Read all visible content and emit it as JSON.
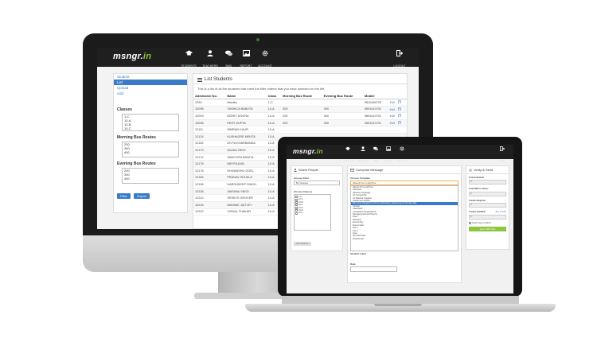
{
  "brand": {
    "logo_text": "msngr.",
    "logo_suffix": "in",
    "accent_color": "#8cc63f",
    "link_color": "#3a7bc8"
  },
  "nav": {
    "items": [
      {
        "label": "STUDENTS",
        "icon": "graduation-cap-icon"
      },
      {
        "label": "TEACHERS",
        "icon": "user-icon"
      },
      {
        "label": "SMS",
        "icon": "chat-bubbles-icon"
      },
      {
        "label": "REPORT",
        "icon": "image-report-icon"
      },
      {
        "label": "ACCOUNT",
        "icon": "gear-icon"
      }
    ],
    "logout": "LOGOUT"
  },
  "desktop": {
    "sidebar": {
      "links": [
        "Student",
        "List",
        "Upload",
        "Add"
      ],
      "classes_label": "Classes",
      "classes": [
        "1-C",
        "10-A",
        "10-B",
        "10-C"
      ],
      "morning_label": "Morning Bus Routes",
      "morning_routes": [
        "200",
        "300",
        "400"
      ],
      "evening_label": "Evening Bus Routes",
      "evening_routes": [
        "200",
        "300",
        "400"
      ],
      "filter_btn": "Filter",
      "export_btn": "Export"
    },
    "main": {
      "title": "List Students",
      "intro": "This is a list of all the students that meet the filter criteria that you have selected on the left.",
      "columns": [
        "Admission No.",
        "Name",
        "Class",
        "Morning Bus Route",
        "Evening Bus Route",
        "Mobile"
      ],
      "rows": [
        {
          "adm": "1299",
          "name": "Manika",
          "cls": "1-C",
          "mbr": "",
          "ebr": "",
          "mobile": "9810489729",
          "edit": "Edit"
        },
        {
          "adm": "12098",
          "name": "YASHICA BABUTA",
          "cls": "10-A",
          "mbr": "300",
          "ebr": "400",
          "mobile": "9891410701",
          "edit": "Edit"
        },
        {
          "adm": "12093",
          "name": "MOHIT DOGRA",
          "cls": "10-A",
          "mbr": "200",
          "ebr": "300",
          "mobile": "9891410701",
          "edit": "Edit"
        },
        {
          "adm": "12098",
          "name": "KRITI GUPTA",
          "cls": "10-A",
          "mbr": "300",
          "ebr": "400",
          "mobile": "9891410701",
          "edit": "Edit"
        },
        {
          "adm": "12111",
          "name": "SIMRAN KAUR",
          "cls": "10-A",
          "mbr": "",
          "ebr": "",
          "mobile": "",
          "edit": ""
        },
        {
          "adm": "12124",
          "name": "KUSHAGRE MEHTA",
          "cls": "10-A",
          "mbr": "",
          "ebr": "",
          "mobile": "",
          "edit": ""
        },
        {
          "adm": "12152",
          "name": "DIVYA KHARBANDA",
          "cls": "10-A",
          "mbr": "",
          "ebr": "",
          "mobile": "",
          "edit": ""
        },
        {
          "adm": "12173",
          "name": "ANJALI NEGI",
          "cls": "10-A",
          "mbr": "",
          "ebr": "",
          "mobile": "",
          "edit": ""
        },
        {
          "adm": "12174",
          "name": "SANCHITA BHATIA",
          "cls": "10-A",
          "mbr": "",
          "ebr": "",
          "mobile": "",
          "edit": ""
        },
        {
          "adm": "12175",
          "name": "MEHTAJAIN",
          "cls": "10-A",
          "mbr": "",
          "ebr": "",
          "mobile": "",
          "edit": ""
        },
        {
          "adm": "12178",
          "name": "SHIVANSHU GOEL",
          "cls": "10-A",
          "mbr": "",
          "ebr": "",
          "mobile": "",
          "edit": ""
        },
        {
          "adm": "12184",
          "name": "PRANAV SHUKLA",
          "cls": "10-A",
          "mbr": "",
          "ebr": "",
          "mobile": "",
          "edit": ""
        },
        {
          "adm": "12196",
          "name": "HARSHDEEP SINGH",
          "cls": "10-A",
          "mbr": "",
          "ebr": "",
          "mobile": "",
          "edit": ""
        },
        {
          "adm": "12208",
          "name": "VAISHALI NEGI",
          "cls": "10-A",
          "mbr": "",
          "ebr": "",
          "mobile": "",
          "edit": ""
        },
        {
          "adm": "12210",
          "name": "SRISHTI GROVER",
          "cls": "10-A",
          "mbr": "",
          "ebr": "",
          "mobile": "",
          "edit": ""
        },
        {
          "adm": "12216",
          "name": "MAYANK JAITLEY",
          "cls": "10-A",
          "mbr": "",
          "ebr": "",
          "mobile": "",
          "edit": ""
        },
        {
          "adm": "12222",
          "name": "VISHAL THAKAR",
          "cls": "10-A",
          "mbr": "",
          "ebr": "",
          "mobile": "",
          "edit": ""
        }
      ]
    }
  },
  "laptop": {
    "select_people": {
      "title": "Select People",
      "filter_label": "Choose Filter",
      "filter_value": "By Classes",
      "classes_label": "Choose Classes",
      "classes": [
        "1-C",
        "10-A",
        "10-B",
        "10-C",
        "10-E",
        "10-E",
        "10-F"
      ],
      "submit": "Add Students"
    },
    "compose": {
      "title": "Compose Message",
      "template_label": "Choose Template",
      "template_value": "Absent For Long/Time",
      "options": [
        "Absent For Long/Time",
        "Absentee",
        "Absence Language",
        "Art Competition",
        "Art Material Supplies",
        "Academics Update",
        "Bus route changed for the fee submission, please pay by the due date",
        "Circular",
        "Classifieds",
        "Competition Registrations",
        "Damaging School Property",
        "Dues",
        "Detention",
        "Events Day",
        "Exams Date",
        "Fee 1",
        "Fee 2",
        "Fees",
        "Fee Reminder",
        "Final Result"
      ],
      "highlighted_index": 6,
      "student_label": "Student Label",
      "date_label": "Date"
    },
    "verify": {
      "title": "Verify & Send",
      "total_individual": "Total Individual",
      "total_individual_val": "0",
      "total_sms": "Total SMS to deliver",
      "total_sms_val": "0",
      "credits_required": "Credits Required",
      "credits_required_val": "0",
      "credits_available": "Credits Available",
      "buy_credits": "Buy Credits",
      "credits_available_val": "0",
      "send_copy": "Send Copy to Admin",
      "send_btn": "Send SMS Now"
    }
  }
}
